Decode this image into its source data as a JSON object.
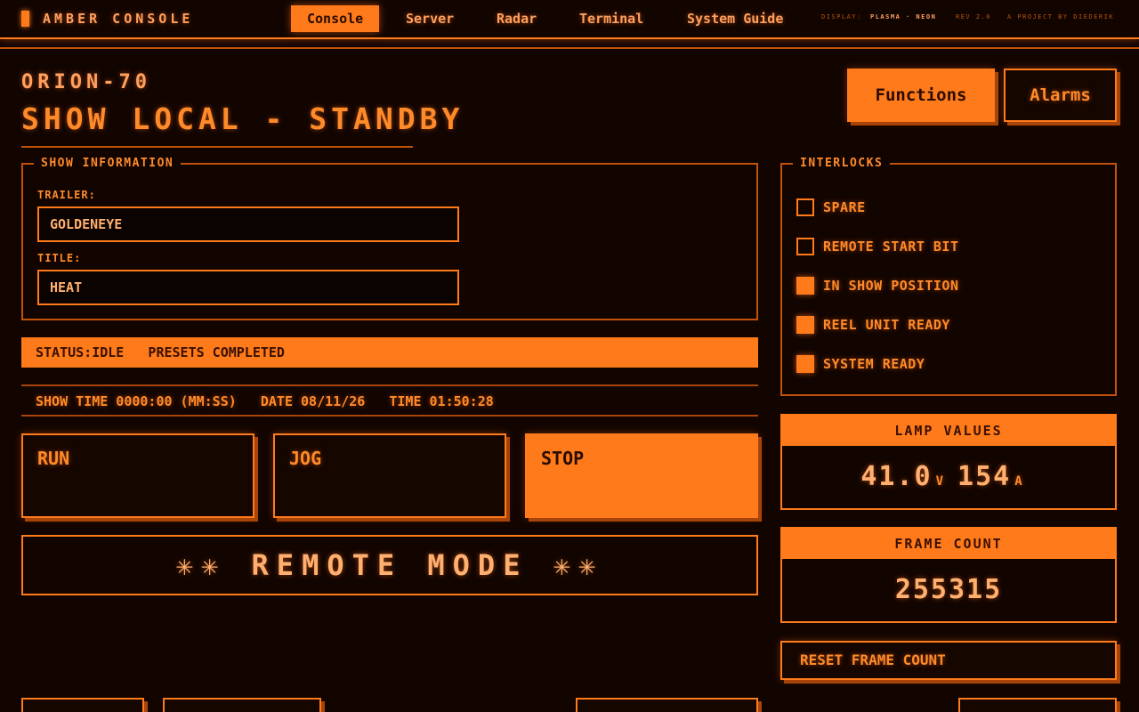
{
  "app": {
    "brand": "AMBER CONSOLE"
  },
  "nav": [
    {
      "label": "Console",
      "active": true
    },
    {
      "label": "Server",
      "active": false
    },
    {
      "label": "Radar",
      "active": false
    },
    {
      "label": "Terminal",
      "active": false
    },
    {
      "label": "System Guide",
      "active": false
    }
  ],
  "meta": {
    "display_label": "DISPLAY:",
    "display_value": "PLASMA · NEON",
    "rev": "REV 2.0",
    "credit": "A PROJECT BY DIEDERIK"
  },
  "header": {
    "model": "ORION-70",
    "mode": "SHOW LOCAL - STANDBY",
    "functions_label": "Functions",
    "alarms_label": "Alarms"
  },
  "show_info": {
    "legend": "SHOW INFORMATION",
    "trailer_label": "TRAILER:",
    "trailer_value": "GOLDENEYE",
    "title_label": "TITLE:",
    "title_value": "HEAT"
  },
  "status": {
    "text": "STATUS:IDLE   PRESETS COMPLETED"
  },
  "timing": {
    "text": "SHOW TIME 0000:00 (MM:SS)   DATE 08/11/26   TIME 01:50:28"
  },
  "controls": {
    "run": "RUN",
    "jog": "JOG",
    "stop": "STOP"
  },
  "remote": {
    "text": "✳✳ REMOTE MODE ✳✳"
  },
  "interlocks": {
    "legend": "INTERLOCKS",
    "items": [
      {
        "label": "SPARE",
        "on": false
      },
      {
        "label": "REMOTE START BIT",
        "on": false
      },
      {
        "label": "IN SHOW POSITION",
        "on": true
      },
      {
        "label": "REEL UNIT READY",
        "on": true
      },
      {
        "label": "SYSTEM READY",
        "on": true
      }
    ]
  },
  "lamp": {
    "title": "LAMP VALUES",
    "volts": "41.0",
    "volts_unit": "V",
    "amps": "154",
    "amps_unit": "A"
  },
  "frames": {
    "title": "FRAME COUNT",
    "value": "255315"
  },
  "reset": {
    "label": "RESET FRAME COUNT"
  },
  "colors": {
    "background": "#120500",
    "accent": "#ff7a1a",
    "dim": "#c2520a"
  }
}
